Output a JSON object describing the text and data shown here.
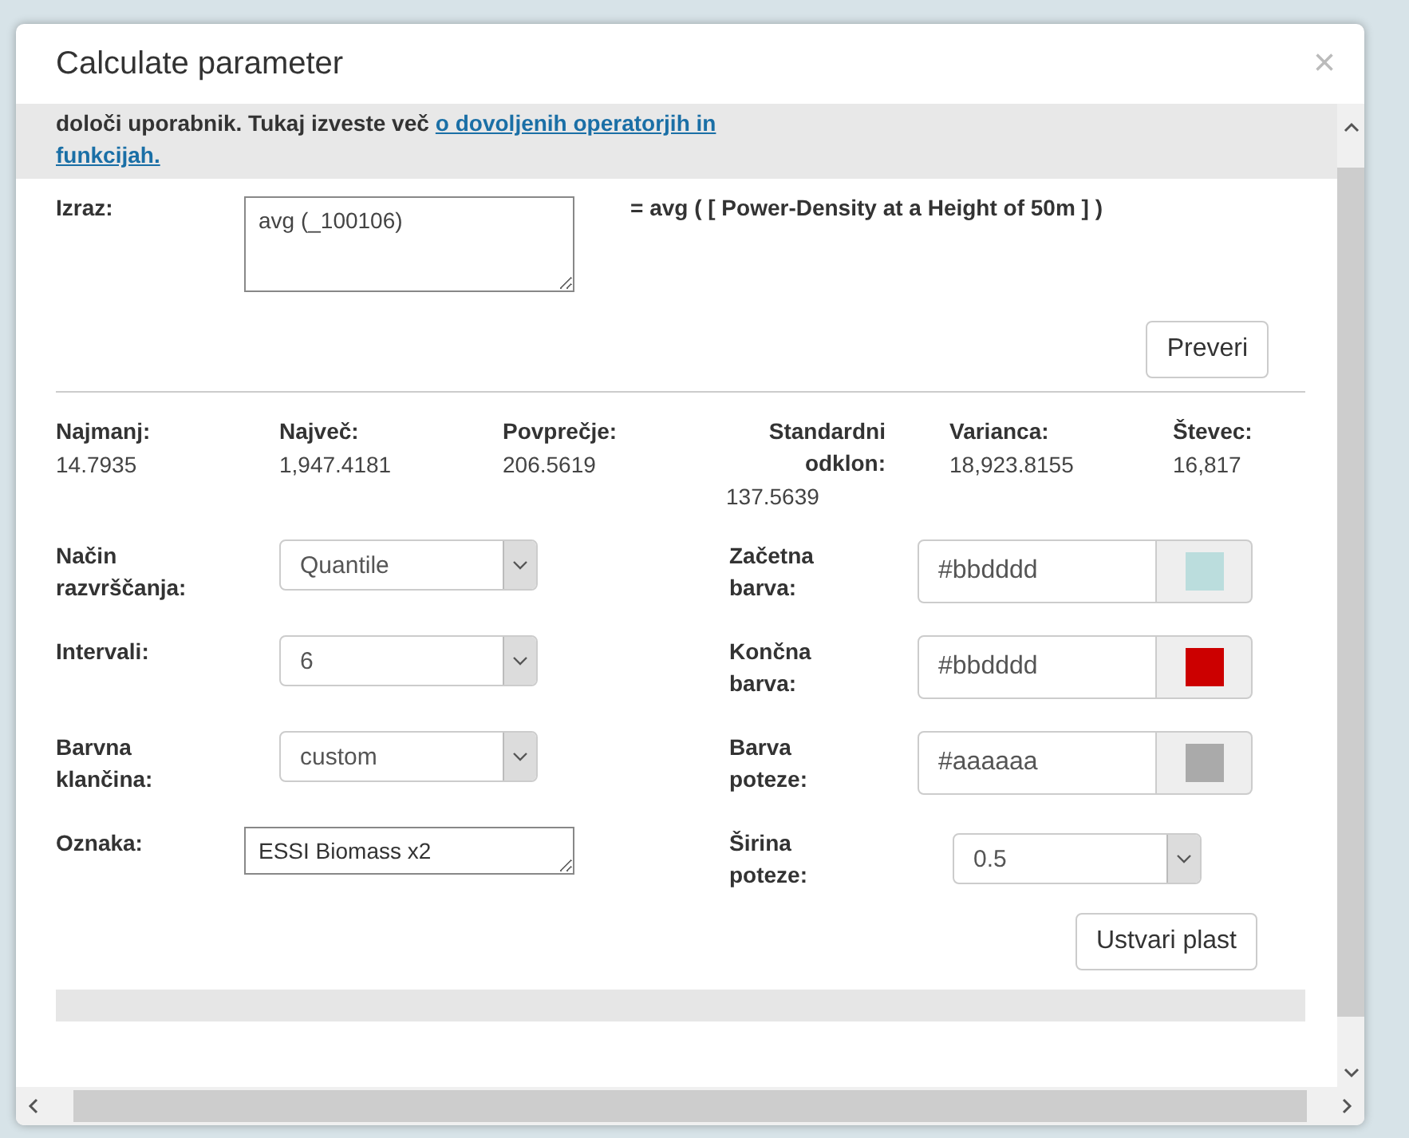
{
  "dialog": {
    "title": "Calculate parameter",
    "close": "×"
  },
  "intro": {
    "text": "določi uporabnik. Tukaj izveste več",
    "link_lines": [
      "o dovoljenih operatorjih in",
      "funkcijah."
    ]
  },
  "expression": {
    "label": "Izraz:",
    "value": "avg (_100106)",
    "preview": "= avg ( [ Power-Density at a Height of 50m ] )"
  },
  "check_button": "Preveri",
  "stats": [
    {
      "label": "Najmanj:",
      "value": "14.7935"
    },
    {
      "label": "Največ:",
      "value": "1,947.4181"
    },
    {
      "label": "Povprečje:",
      "value": "206.5619"
    },
    {
      "label": "Standardni odklon:",
      "value": "137.5639"
    },
    {
      "label": "Varianca:",
      "value": "18,923.8155"
    },
    {
      "label": "Števec:",
      "value": "16,817"
    }
  ],
  "left_fields": [
    {
      "kind": "select",
      "label": "Način razvrščanja:",
      "value": "Quantile"
    },
    {
      "kind": "select",
      "label": "Intervali:",
      "value": "6"
    },
    {
      "kind": "select",
      "label": "Barvna klančina:",
      "value": "custom"
    },
    {
      "kind": "text",
      "label": "Oznaka:",
      "value": "ESSI Biomass x2"
    }
  ],
  "right_fields": [
    {
      "kind": "color",
      "label": "Začetna barva:",
      "value": "#bbdddd",
      "color": "#bbdddd"
    },
    {
      "kind": "color",
      "label": "Končna barva:",
      "value": "#bbdddd",
      "color": "#cc0000"
    },
    {
      "kind": "color",
      "label": "Barva poteze:",
      "value": "#aaaaaa",
      "color": "#aaaaaa"
    },
    {
      "kind": "select",
      "label": "Širina poteze:",
      "value": "0.5"
    }
  ],
  "create_button": "Ustvari plast"
}
